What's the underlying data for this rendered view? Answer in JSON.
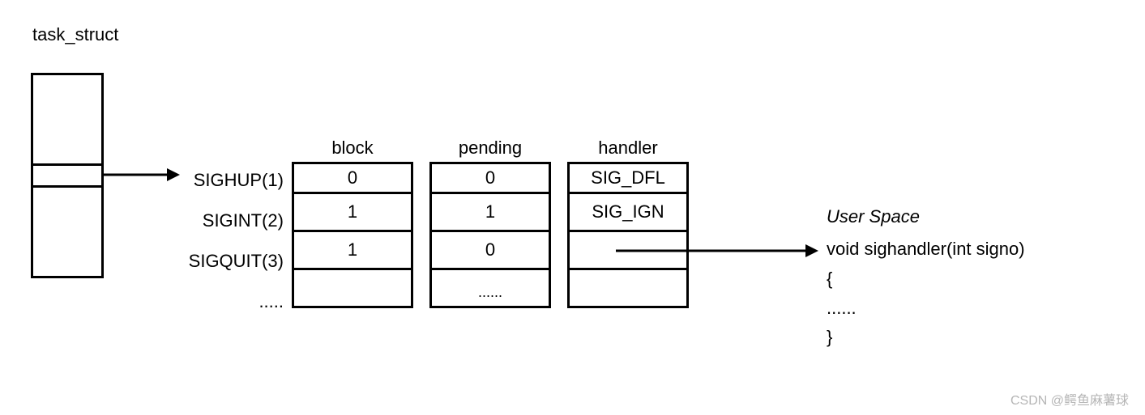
{
  "title": "task_struct",
  "columns": {
    "block": "block",
    "pending": "pending",
    "handler": "handler"
  },
  "rows": {
    "r1": "SIGHUP(1)",
    "r2": "SIGINT(2)",
    "r3": "SIGQUIT(3)",
    "r4": "....."
  },
  "blockVals": {
    "r1": "0",
    "r2": "1",
    "r3": "1"
  },
  "pendingVals": {
    "r1": "0",
    "r2": "1",
    "r3": "0",
    "r4": "......"
  },
  "handlerVals": {
    "r1": "SIG_DFL",
    "r2": "SIG_IGN"
  },
  "userSpace": {
    "title": "User Space",
    "line1": "void sighandler(int signo)",
    "line2": "{",
    "line3": "......",
    "line4": "}"
  },
  "watermark": "CSDN @鳄鱼麻薯球"
}
